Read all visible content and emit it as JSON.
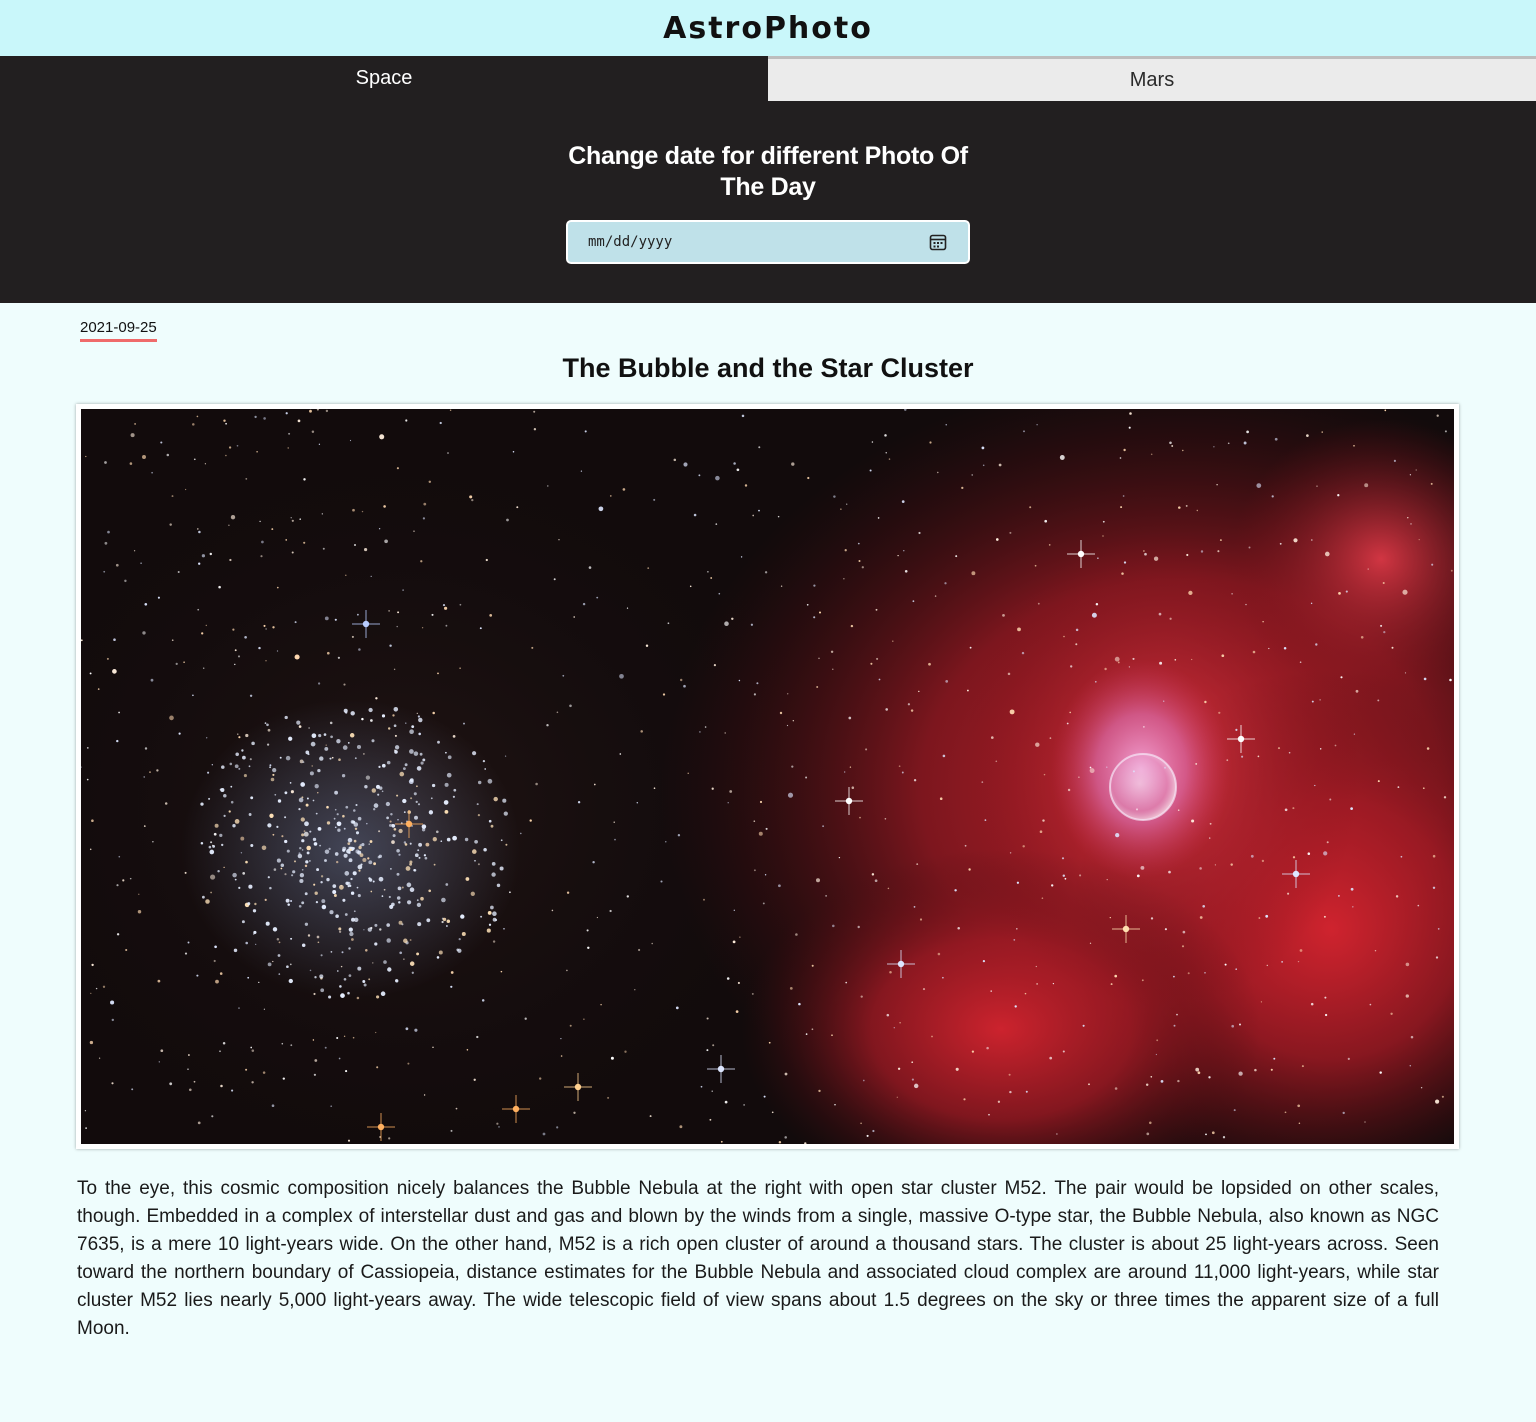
{
  "header": {
    "title": "AstroPhoto"
  },
  "tabs": [
    {
      "label": "Space",
      "active": true
    },
    {
      "label": "Mars",
      "active": false
    }
  ],
  "date_panel": {
    "heading": "Change date for different Photo Of The Day",
    "date_input": {
      "placeholder": "mm/dd/yyyy",
      "value": ""
    },
    "icon": "calendar-icon"
  },
  "photo": {
    "date": "2021-09-25",
    "title": "The Bubble and the Star Cluster",
    "image_alt": "The Bubble Nebula and star cluster M52",
    "explanation": "To the eye, this cosmic composition nicely balances the Bubble Nebula at the right with open star cluster M52. The pair would be lopsided on other scales, though. Embedded in a complex of interstellar dust and gas and blown by the winds from a single, massive O-type star, the Bubble Nebula, also known as NGC 7635, is a mere 10 light-years wide. On the other hand, M52 is a rich open cluster of around a thousand stars. The cluster is about 25 light-years across. Seen toward the northern boundary of Cassiopeia, distance estimates for the Bubble Nebula and associated cloud complex are around 11,000 light-years, while star cluster M52 lies nearly 5,000 light-years away. The wide telescopic field of view spans about 1.5 degrees on the sky or three times the apparent size of a full Moon."
  },
  "colors": {
    "header_bg": "#c9f7fa",
    "dark_bg": "#221f20",
    "page_bg": "#effdfd",
    "date_underline": "#ef6b6b",
    "input_bg": "#bfe1e9"
  }
}
